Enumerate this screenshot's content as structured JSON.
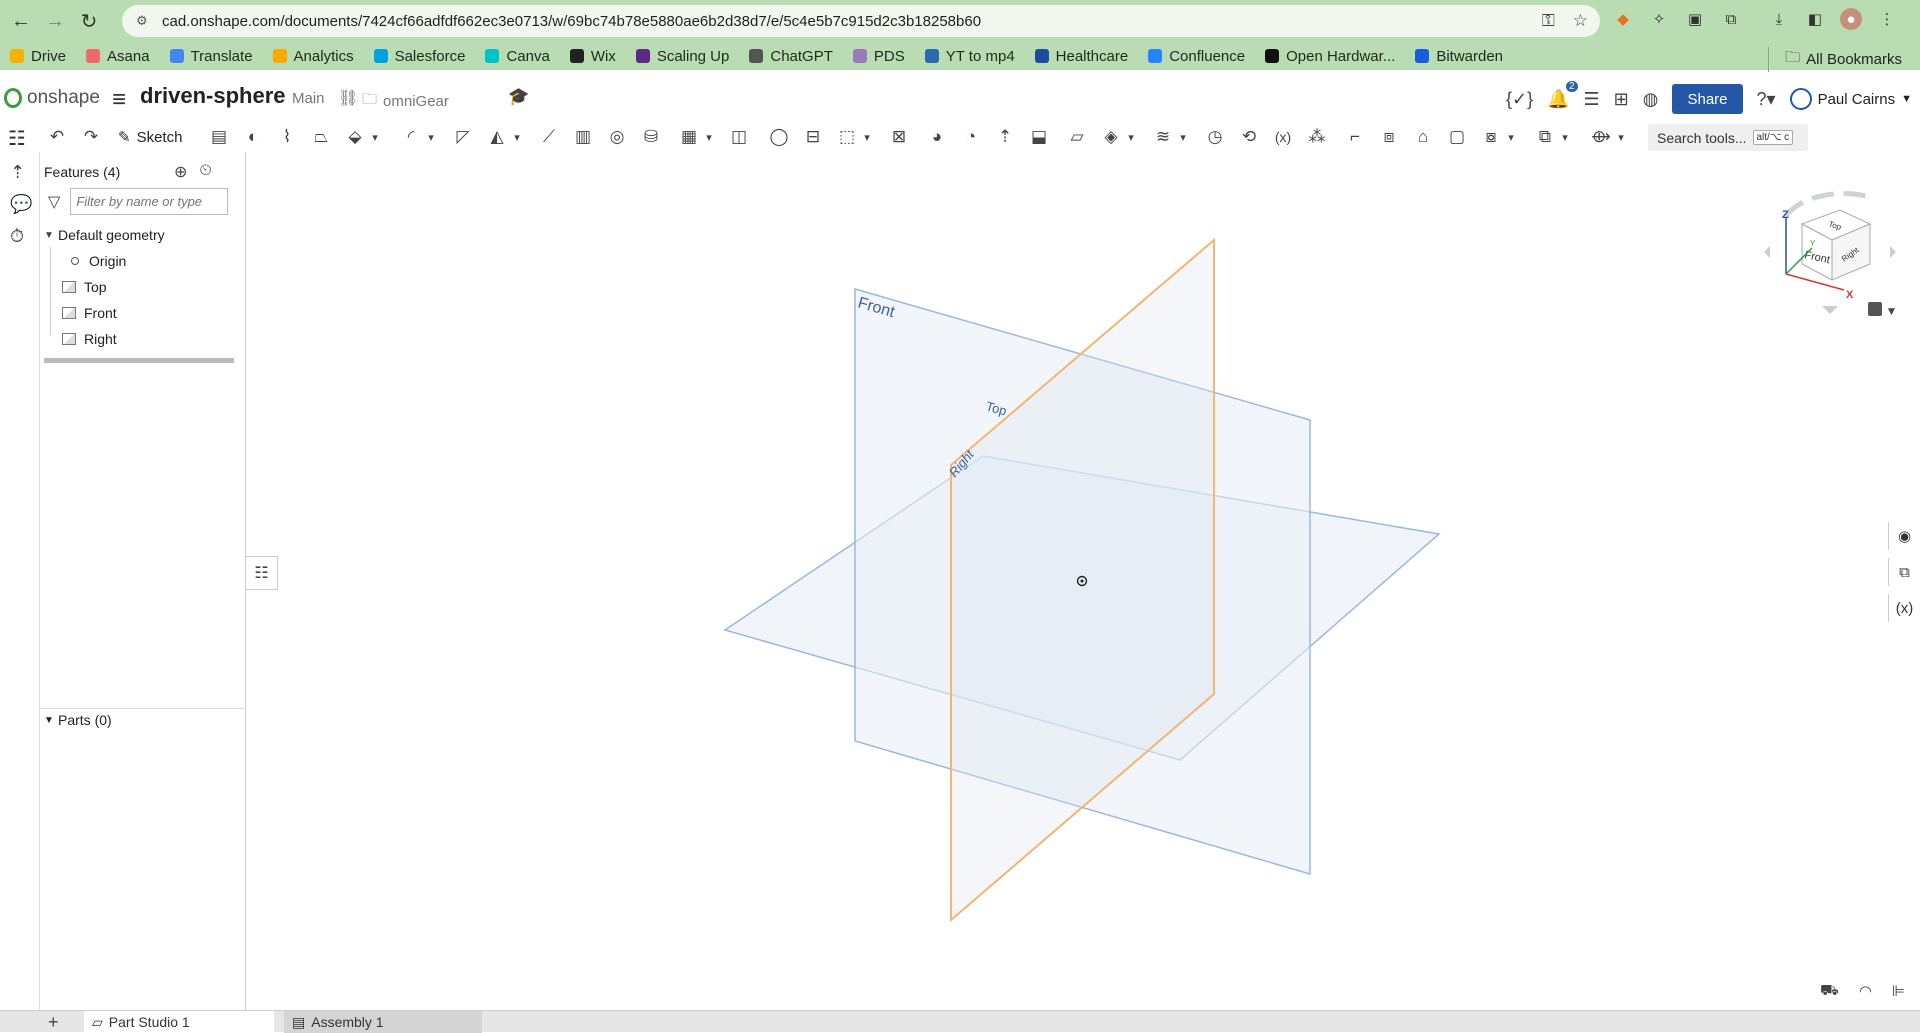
{
  "browser": {
    "url": "cad.onshape.com/documents/7424cf66adfdf662ec3e0713/w/69bc74b78e5880ae6b2d38d7/e/5c4e5b7c915d2c3b18258b60",
    "bookmarks": [
      {
        "label": "Drive",
        "color": "#f4b400"
      },
      {
        "label": "Asana",
        "color": "#f06a6a"
      },
      {
        "label": "Translate",
        "color": "#4285f4"
      },
      {
        "label": "Analytics",
        "color": "#f9ab00"
      },
      {
        "label": "Salesforce",
        "color": "#00a1e0"
      },
      {
        "label": "Canva",
        "color": "#00c4cc"
      },
      {
        "label": "Wix",
        "color": "#222222"
      },
      {
        "label": "Scaling Up",
        "color": "#5b2a86"
      },
      {
        "label": "ChatGPT",
        "color": "#555555"
      },
      {
        "label": "PDS",
        "color": "#9a7bb8"
      },
      {
        "label": "YT to mp4",
        "color": "#2b6cb0"
      },
      {
        "label": "Healthcare",
        "color": "#1a4fa0"
      },
      {
        "label": "Confluence",
        "color": "#2684ff"
      },
      {
        "label": "Open Hardwar...",
        "color": "#111111"
      },
      {
        "label": "Bitwarden",
        "color": "#175ddc"
      }
    ],
    "all_bookmarks": "All Bookmarks"
  },
  "app": {
    "logo_text": "onshape",
    "doc_title": "driven-sphere",
    "branch": "Main",
    "folder": "omniGear",
    "notifications_count": "2",
    "share_label": "Share",
    "user_name": "Paul Cairns",
    "accent": "#2458a7"
  },
  "toolbar": {
    "sketch_label": "Sketch",
    "search_label": "Search tools...",
    "search_shortcut": "alt/⌥ c"
  },
  "panel": {
    "features_header": "Features (4)",
    "filter_placeholder": "Filter by name or type",
    "default_geometry": "Default geometry",
    "items": [
      "Origin",
      "Top",
      "Front",
      "Right"
    ],
    "parts_header": "Parts (0)"
  },
  "viewport": {
    "plane_labels": {
      "front": "Front",
      "top": "Top",
      "right": "Right"
    },
    "cube_labels": {
      "top": "Top",
      "front": "Front",
      "right": "Right",
      "z": "Z",
      "x": "X",
      "y": "Y"
    }
  },
  "tabs": [
    "Part Studio 1",
    "Assembly 1"
  ]
}
